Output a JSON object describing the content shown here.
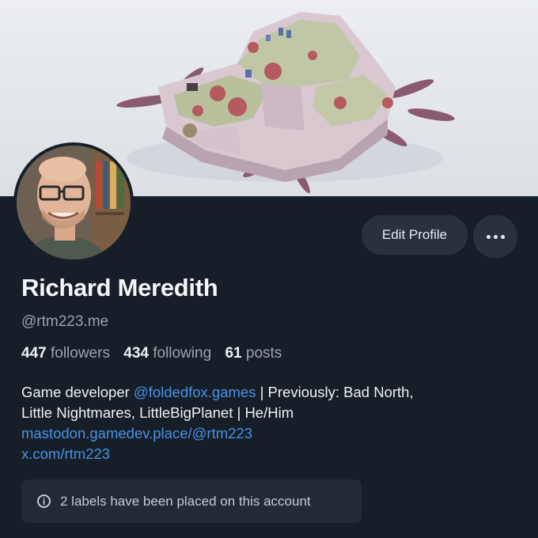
{
  "profile": {
    "name": "Richard Meredith",
    "handle": "@rtm223.me",
    "stats": {
      "followers_count": "447",
      "followers_label": "followers",
      "following_count": "434",
      "following_label": "following",
      "posts_count": "61",
      "posts_label": "posts"
    },
    "bio": {
      "line1_prefix": "Game developer ",
      "line1_link": "@foldedfox.games",
      "line1_suffix": " | Previously: Bad North,",
      "line2": "Little Nightmares, LittleBigPlanet | He/Him",
      "link1": "mastodon.gamedev.place/@rtm223",
      "link2": "x.com/rtm223"
    },
    "labels_notice": "2 labels have been placed on this account"
  },
  "actions": {
    "edit_label": "Edit Profile",
    "more_icon": "ellipsis-icon"
  },
  "colors": {
    "background": "#161e27",
    "button": "#29313c",
    "link": "#4a90e6",
    "muted_text": "#9aa3ad"
  }
}
